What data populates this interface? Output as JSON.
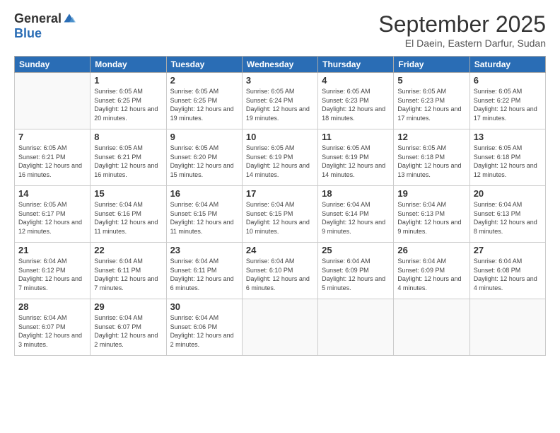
{
  "header": {
    "logo_general": "General",
    "logo_blue": "Blue",
    "month_title": "September 2025",
    "subtitle": "El Daein, Eastern Darfur, Sudan"
  },
  "days_of_week": [
    "Sunday",
    "Monday",
    "Tuesday",
    "Wednesday",
    "Thursday",
    "Friday",
    "Saturday"
  ],
  "weeks": [
    [
      {
        "day": null
      },
      {
        "day": "1",
        "sunrise": "6:05 AM",
        "sunset": "6:25 PM",
        "daylight": "12 hours and 20 minutes."
      },
      {
        "day": "2",
        "sunrise": "6:05 AM",
        "sunset": "6:25 PM",
        "daylight": "12 hours and 19 minutes."
      },
      {
        "day": "3",
        "sunrise": "6:05 AM",
        "sunset": "6:24 PM",
        "daylight": "12 hours and 19 minutes."
      },
      {
        "day": "4",
        "sunrise": "6:05 AM",
        "sunset": "6:23 PM",
        "daylight": "12 hours and 18 minutes."
      },
      {
        "day": "5",
        "sunrise": "6:05 AM",
        "sunset": "6:23 PM",
        "daylight": "12 hours and 17 minutes."
      },
      {
        "day": "6",
        "sunrise": "6:05 AM",
        "sunset": "6:22 PM",
        "daylight": "12 hours and 17 minutes."
      }
    ],
    [
      {
        "day": "7",
        "sunrise": "6:05 AM",
        "sunset": "6:21 PM",
        "daylight": "12 hours and 16 minutes."
      },
      {
        "day": "8",
        "sunrise": "6:05 AM",
        "sunset": "6:21 PM",
        "daylight": "12 hours and 16 minutes."
      },
      {
        "day": "9",
        "sunrise": "6:05 AM",
        "sunset": "6:20 PM",
        "daylight": "12 hours and 15 minutes."
      },
      {
        "day": "10",
        "sunrise": "6:05 AM",
        "sunset": "6:19 PM",
        "daylight": "12 hours and 14 minutes."
      },
      {
        "day": "11",
        "sunrise": "6:05 AM",
        "sunset": "6:19 PM",
        "daylight": "12 hours and 14 minutes."
      },
      {
        "day": "12",
        "sunrise": "6:05 AM",
        "sunset": "6:18 PM",
        "daylight": "12 hours and 13 minutes."
      },
      {
        "day": "13",
        "sunrise": "6:05 AM",
        "sunset": "6:18 PM",
        "daylight": "12 hours and 12 minutes."
      }
    ],
    [
      {
        "day": "14",
        "sunrise": "6:05 AM",
        "sunset": "6:17 PM",
        "daylight": "12 hours and 12 minutes."
      },
      {
        "day": "15",
        "sunrise": "6:04 AM",
        "sunset": "6:16 PM",
        "daylight": "12 hours and 11 minutes."
      },
      {
        "day": "16",
        "sunrise": "6:04 AM",
        "sunset": "6:15 PM",
        "daylight": "12 hours and 11 minutes."
      },
      {
        "day": "17",
        "sunrise": "6:04 AM",
        "sunset": "6:15 PM",
        "daylight": "12 hours and 10 minutes."
      },
      {
        "day": "18",
        "sunrise": "6:04 AM",
        "sunset": "6:14 PM",
        "daylight": "12 hours and 9 minutes."
      },
      {
        "day": "19",
        "sunrise": "6:04 AM",
        "sunset": "6:13 PM",
        "daylight": "12 hours and 9 minutes."
      },
      {
        "day": "20",
        "sunrise": "6:04 AM",
        "sunset": "6:13 PM",
        "daylight": "12 hours and 8 minutes."
      }
    ],
    [
      {
        "day": "21",
        "sunrise": "6:04 AM",
        "sunset": "6:12 PM",
        "daylight": "12 hours and 7 minutes."
      },
      {
        "day": "22",
        "sunrise": "6:04 AM",
        "sunset": "6:11 PM",
        "daylight": "12 hours and 7 minutes."
      },
      {
        "day": "23",
        "sunrise": "6:04 AM",
        "sunset": "6:11 PM",
        "daylight": "12 hours and 6 minutes."
      },
      {
        "day": "24",
        "sunrise": "6:04 AM",
        "sunset": "6:10 PM",
        "daylight": "12 hours and 6 minutes."
      },
      {
        "day": "25",
        "sunrise": "6:04 AM",
        "sunset": "6:09 PM",
        "daylight": "12 hours and 5 minutes."
      },
      {
        "day": "26",
        "sunrise": "6:04 AM",
        "sunset": "6:09 PM",
        "daylight": "12 hours and 4 minutes."
      },
      {
        "day": "27",
        "sunrise": "6:04 AM",
        "sunset": "6:08 PM",
        "daylight": "12 hours and 4 minutes."
      }
    ],
    [
      {
        "day": "28",
        "sunrise": "6:04 AM",
        "sunset": "6:07 PM",
        "daylight": "12 hours and 3 minutes."
      },
      {
        "day": "29",
        "sunrise": "6:04 AM",
        "sunset": "6:07 PM",
        "daylight": "12 hours and 2 minutes."
      },
      {
        "day": "30",
        "sunrise": "6:04 AM",
        "sunset": "6:06 PM",
        "daylight": "12 hours and 2 minutes."
      },
      {
        "day": null
      },
      {
        "day": null
      },
      {
        "day": null
      },
      {
        "day": null
      }
    ]
  ],
  "labels": {
    "sunrise_prefix": "Sunrise: ",
    "sunset_prefix": "Sunset: ",
    "daylight_prefix": "Daylight: "
  }
}
